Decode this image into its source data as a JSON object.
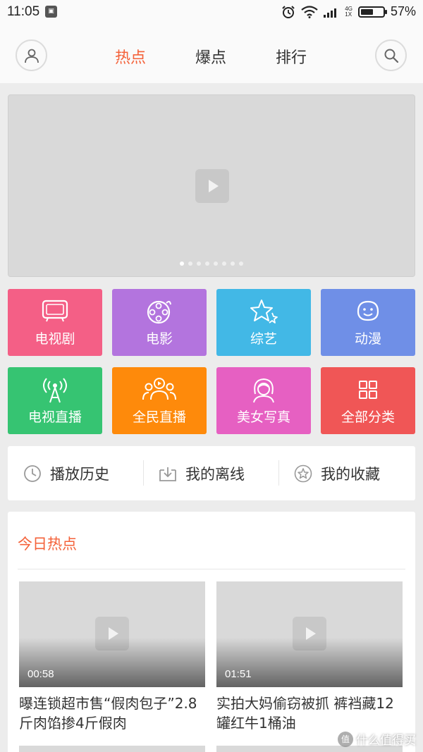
{
  "status_bar": {
    "time": "11:05",
    "notification_icon": "qr-notification-icon",
    "network_top": "4G",
    "network_bottom": "1X",
    "battery_percent_text": "57%",
    "battery_level": 0.57
  },
  "header": {
    "tabs": [
      {
        "label": "热点",
        "active": true
      },
      {
        "label": "爆点",
        "active": false
      },
      {
        "label": "排行",
        "active": false
      }
    ],
    "left_icon": "user-icon",
    "right_icon": "search-icon"
  },
  "banner": {
    "page_count": 8,
    "active_index": 0
  },
  "categories": [
    {
      "label": "电视剧",
      "icon": "tv-icon",
      "color": "#f45f86"
    },
    {
      "label": "电影",
      "icon": "film-reel-icon",
      "color": "#b374de"
    },
    {
      "label": "综艺",
      "icon": "stars-icon",
      "color": "#42b8e6"
    },
    {
      "label": "动漫",
      "icon": "cartoon-face-icon",
      "color": "#6f8fe7"
    },
    {
      "label": "电视直播",
      "icon": "broadcast-tower-icon",
      "color": "#36c472"
    },
    {
      "label": "全民直播",
      "icon": "live-audience-icon",
      "color": "#fe8a0b"
    },
    {
      "label": "美女写真",
      "icon": "girl-portrait-icon",
      "color": "#e660c2"
    },
    {
      "label": "全部分类",
      "icon": "grid-icon",
      "color": "#f05656"
    }
  ],
  "shortcuts": [
    {
      "label": "播放历史",
      "icon": "clock-icon"
    },
    {
      "label": "我的离线",
      "icon": "download-icon"
    },
    {
      "label": "我的收藏",
      "icon": "star-icon"
    }
  ],
  "hot_section": {
    "title": "今日热点",
    "videos": [
      {
        "duration": "00:58",
        "title": "曝连锁超市售“假肉包子”2.8斤肉馅掺4斤假肉"
      },
      {
        "duration": "01:51",
        "title": "实拍大妈偷窃被抓 裤裆藏12罐红牛1桶油"
      }
    ]
  },
  "watermark": {
    "badge": "值",
    "text": "什么值得买"
  },
  "colors": {
    "accent": "#f4623a",
    "background": "#ececec"
  }
}
